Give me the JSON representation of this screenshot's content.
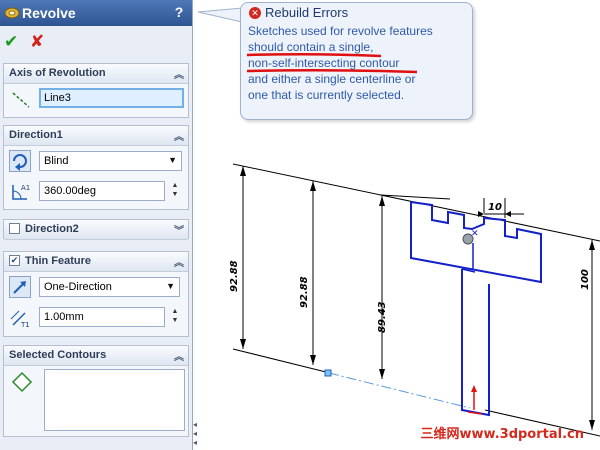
{
  "panel": {
    "title": "Revolve",
    "help": "?",
    "ok_symbol": "✔",
    "cancel_symbol": "✘",
    "axis": {
      "header": "Axis of Revolution",
      "value": "Line3"
    },
    "direction1": {
      "header": "Direction1",
      "type": "Blind",
      "angle": "360.00deg"
    },
    "direction2": {
      "header": "Direction2",
      "checked": false
    },
    "thin": {
      "header": "Thin Feature",
      "checked": true,
      "type": "One-Direction",
      "thickness": "1.00mm"
    },
    "contours": {
      "header": "Selected Contours"
    }
  },
  "error": {
    "title": "Rebuild Errors",
    "lines": [
      "Sketches used for revolve features",
      "should contain a single,",
      "non-self-intersecting contour",
      "and either a single centerline or",
      "one that is currently selected."
    ]
  },
  "dimensions": {
    "d1": "92.88",
    "d2": "92.88",
    "d3": "89.43",
    "d4": "100",
    "d5": "10"
  },
  "watermark": "三维网www.3dportal.cn",
  "colors": {
    "titlebar": "#3a64a6",
    "sketch": "#1420c8",
    "error_underline": "#e01010",
    "link_text": "#2e5aa8"
  }
}
